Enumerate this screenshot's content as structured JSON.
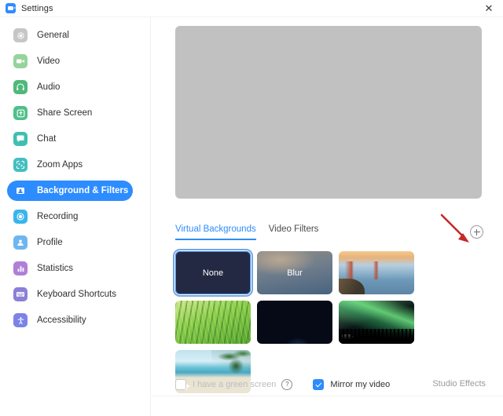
{
  "window": {
    "title": "Settings",
    "logo_icon": "zoom-camera-icon",
    "close_icon": "close-icon"
  },
  "sidebar": {
    "items": [
      {
        "label": "General",
        "icon": "gear-icon",
        "color": "#c6c6c6",
        "active": false
      },
      {
        "label": "Video",
        "icon": "camera-icon",
        "color": "#95d49a",
        "active": false
      },
      {
        "label": "Audio",
        "icon": "headphones-icon",
        "color": "#4fb97a",
        "active": false
      },
      {
        "label": "Share Screen",
        "icon": "upload-icon",
        "color": "#4fc08a",
        "active": false
      },
      {
        "label": "Chat",
        "icon": "chat-icon",
        "color": "#3fc0ae",
        "active": false
      },
      {
        "label": "Zoom Apps",
        "icon": "apps-icon",
        "color": "#45bfc0",
        "active": false
      },
      {
        "label": "Background & Filters",
        "icon": "person-card-icon",
        "color": "#2d8cff",
        "active": true
      },
      {
        "label": "Recording",
        "icon": "record-icon",
        "color": "#39b5ec",
        "active": false
      },
      {
        "label": "Profile",
        "icon": "person-icon",
        "color": "#6fb6f0",
        "active": false
      },
      {
        "label": "Statistics",
        "icon": "bar-chart-icon",
        "color": "#b07fd6",
        "active": false
      },
      {
        "label": "Keyboard Shortcuts",
        "icon": "keyboard-icon",
        "color": "#8b7fd6",
        "active": false
      },
      {
        "label": "Accessibility",
        "icon": "accessibility-icon",
        "color": "#7b83e8",
        "active": false
      }
    ]
  },
  "main": {
    "preview": {
      "name": "video-preview",
      "state": "blank"
    },
    "tabs": [
      {
        "label": "Virtual Backgrounds",
        "active": true
      },
      {
        "label": "Video Filters",
        "active": false
      }
    ],
    "add_button": {
      "icon": "plus-icon",
      "label": "+"
    },
    "annotation": {
      "type": "red-arrow",
      "color": "#c62828",
      "points_to": "add-background-button"
    },
    "backgrounds": [
      {
        "label": "None",
        "art": "art-none",
        "selected": true,
        "video": false
      },
      {
        "label": "Blur",
        "art": "art-blur",
        "selected": false,
        "video": false
      },
      {
        "label": "",
        "art": "art-bridge",
        "selected": false,
        "video": false
      },
      {
        "label": "",
        "art": "art-grass",
        "selected": false,
        "video": false
      },
      {
        "label": "",
        "art": "art-earth",
        "selected": false,
        "video": false
      },
      {
        "label": "",
        "art": "art-aurora",
        "selected": false,
        "video": true
      },
      {
        "label": "",
        "art": "art-beach",
        "selected": false,
        "video": true
      }
    ],
    "footer": {
      "green_screen_label": "I have a green screen",
      "green_screen_checked": false,
      "green_screen_disabled": true,
      "help_icon": "question-mark-icon",
      "help_glyph": "?",
      "mirror_label": "Mirror my video",
      "mirror_checked": true,
      "studio_effects_label": "Studio Effects"
    }
  },
  "colors": {
    "accent": "#2d8cff",
    "annotation_red": "#c62828",
    "preview_gray": "#c1c1c1"
  }
}
